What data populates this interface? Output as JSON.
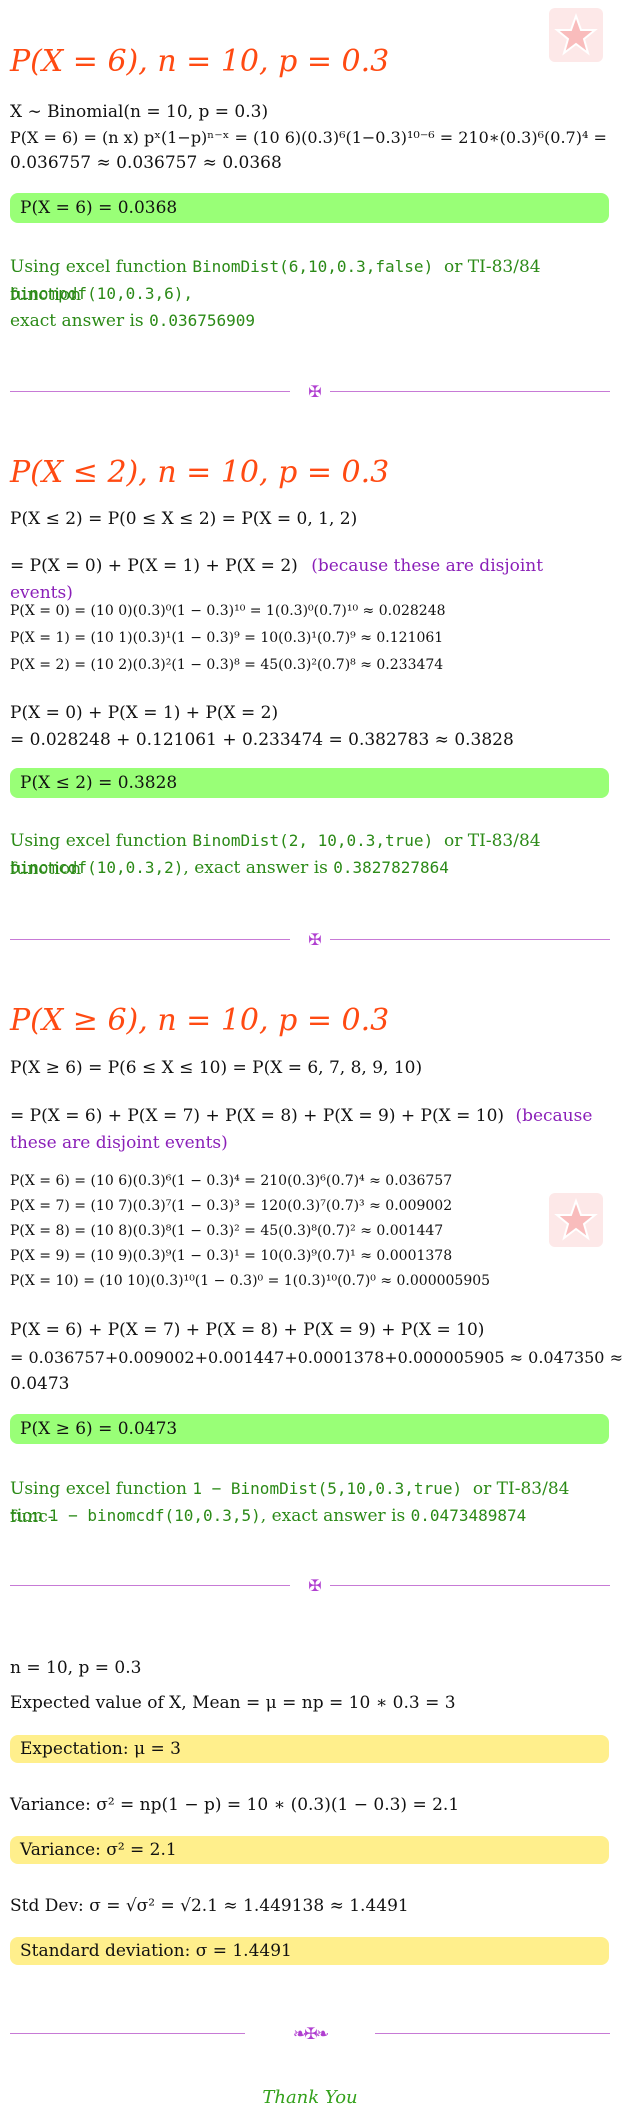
{
  "s1": {
    "title": "P(X = 6), n = 10, p = 0.3",
    "dist": "X ∼ Binomial(n = 10, p = 0.3)",
    "formula_line1": "P(X = 6) = (n x) pˣ(1−p)ⁿ⁻ˣ = (10 6)(0.3)⁶(1−0.3)¹⁰⁻⁶ = 210∗(0.3)⁶(0.7)⁴ =",
    "formula_line2": "0.036757 ≈ 0.036757 ≈ 0.0368",
    "result": "P(X = 6) = 0.0368",
    "excel_prefix": "Using excel function",
    "excel_fn": "BinomDist(6,10,0.3,false)",
    "ti_prefix": "or TI-83/84 function",
    "ti_fn": "binompdf(10,0.3,6),",
    "exact_prefix": "exact answer is",
    "exact_value": "0.036756909"
  },
  "s2": {
    "title": "P(X ≤ 2), n = 10, p = 0.3",
    "line1": "P(X ≤ 2) = P(0 ≤ X ≤ 2) = P(X = 0, 1, 2)",
    "line2": "= P(X = 0) + P(X = 1) + P(X = 2)",
    "line2_note": "(because these are disjoint events)",
    "terms": [
      "P(X = 0) = (10 0)(0.3)⁰(1 − 0.3)¹⁰ = 1(0.3)⁰(0.7)¹⁰ ≈ 0.028248",
      "P(X = 1) = (10 1)(0.3)¹(1 − 0.3)⁹ = 10(0.3)¹(0.7)⁹ ≈ 0.121061",
      "P(X = 2) = (10 2)(0.3)²(1 − 0.3)⁸ = 45(0.3)²(0.7)⁸ ≈ 0.233474"
    ],
    "sum_line1": "P(X = 0) + P(X = 1) + P(X = 2)",
    "sum_line2": "= 0.028248 + 0.121061 + 0.233474 = 0.382783 ≈ 0.3828",
    "result": "P(X ≤ 2) = 0.3828",
    "excel_prefix": "Using excel function",
    "excel_fn": "BinomDist(2, 10,0.3,true)",
    "ti_prefix": "or TI-83/84 function",
    "ti_fn": "binomcdf(10,0.3,2)",
    "exact_prefix": ", exact answer is",
    "exact_value": "0.3827827864"
  },
  "s3": {
    "title": "P(X ≥ 6), n = 10, p = 0.3",
    "line1": "P(X ≥ 6) = P(6 ≤ X ≤ 10) = P(X = 6, 7, 8, 9, 10)",
    "line2": "= P(X = 6) + P(X = 7) + P(X = 8) + P(X = 9) + P(X = 10)",
    "line2_note_a": "(because",
    "line2_note_b": "these are disjoint events)",
    "terms": [
      "P(X = 6) = (10 6)(0.3)⁶(1 − 0.3)⁴ = 210(0.3)⁶(0.7)⁴ ≈ 0.036757",
      "P(X = 7) = (10 7)(0.3)⁷(1 − 0.3)³ = 120(0.3)⁷(0.7)³ ≈ 0.009002",
      "P(X = 8) = (10 8)(0.3)⁸(1 − 0.3)² = 45(0.3)⁸(0.7)² ≈ 0.001447",
      "P(X = 9) = (10 9)(0.3)⁹(1 − 0.3)¹ = 10(0.3)⁹(0.7)¹ ≈ 0.0001378",
      "P(X = 10) = (10 10)(0.3)¹⁰(1 − 0.3)⁰ = 1(0.3)¹⁰(0.7)⁰ ≈ 0.000005905"
    ],
    "sum_line1": "P(X = 6) + P(X = 7) + P(X = 8) + P(X = 9) + P(X = 10)",
    "sum_line2": "= 0.036757+0.009002+0.001447+0.0001378+0.000005905 ≈ 0.047350 ≈",
    "sum_line3": "0.0473",
    "result": "P(X ≥ 6) = 0.0473",
    "excel_prefix": "Using excel function",
    "excel_fn": "1 − BinomDist(5,10,0.3,true)",
    "ti_prefix": "or TI-83/84 func-",
    "ti_prefix2": "tion",
    "ti_fn": "1 − binomcdf(10,0.3,5)",
    "exact_prefix": ", exact answer is",
    "exact_value": "0.0473489874"
  },
  "s4": {
    "params": "n = 10, p = 0.3",
    "mean_line": "Expected value of X, Mean = μ = np = 10 ∗ 0.3 = 3",
    "mean_box": "Expectation:  μ = 3",
    "var_line": "Variance:  σ² = np(1 − p) = 10 ∗ (0.3)(1 − 0.3) = 2.1",
    "var_box": "Variance:  σ² = 2.1",
    "sd_line": "Std Dev:  σ = √σ² = √2.1 ≈ 1.449138 ≈ 1.4491",
    "sd_box": "Standard deviation:  σ = 1.4491"
  },
  "footer": {
    "thanks": "Thank You"
  },
  "colors": {
    "title": "#ff4a12",
    "green_text": "#2b8a17",
    "result_green": "#99ff77",
    "result_yellow": "#ffef8c",
    "purple": "#8a1fb8"
  },
  "icons": [
    "star-watermark-icon",
    "ornament-divider-icon"
  ]
}
